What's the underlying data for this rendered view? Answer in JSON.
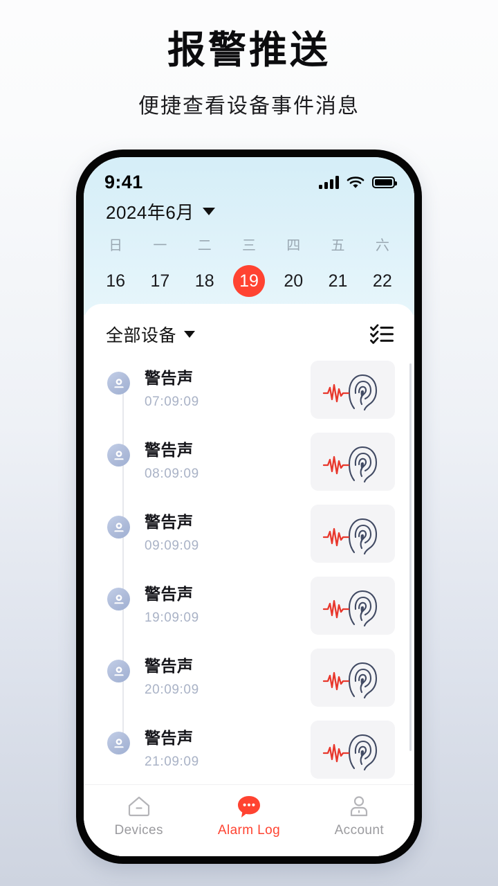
{
  "promo": {
    "title": "报警推送",
    "subtitle": "便捷查看设备事件消息"
  },
  "colors": {
    "accent": "#ff4331",
    "page_bg_top": "#fcfcfd",
    "page_bg_bottom": "#ced4e0",
    "calendar_bg": "#ddf1f9",
    "thumb_bg": "#f4f4f6",
    "wave_red": "#e8372c",
    "ear_navy": "#414a63",
    "device_icon": "#aebbd9",
    "muted_text": "#a9b2c6",
    "tab_inactive": "#9a9a9e"
  },
  "statusbar": {
    "time": "9:41",
    "signal_icon": "cellular-signal-icon",
    "wifi_icon": "wifi-icon",
    "battery_icon": "battery-full-icon"
  },
  "header": {
    "month_label": "2024年6月",
    "caret_icon": "chevron-down-icon"
  },
  "calendar": {
    "weekday_names": [
      "日",
      "一",
      "二",
      "三",
      "四",
      "五",
      "六"
    ],
    "days": [
      {
        "num": "16",
        "selected": false,
        "has_event": true
      },
      {
        "num": "17",
        "selected": false,
        "has_event": true
      },
      {
        "num": "18",
        "selected": false,
        "has_event": true
      },
      {
        "num": "19",
        "selected": true,
        "has_event": true
      },
      {
        "num": "20",
        "selected": false,
        "has_event": false
      },
      {
        "num": "21",
        "selected": false,
        "has_event": false
      },
      {
        "num": "22",
        "selected": false,
        "has_event": false
      }
    ]
  },
  "filterbar": {
    "device_filter_label": "全部设备",
    "caret_icon": "chevron-down-icon",
    "select_icon": "checklist-select-icon"
  },
  "alarm_list": {
    "items": [
      {
        "title": "警告声",
        "time": "07:09:09",
        "device_icon": "camera-icon",
        "thumb_icon": "ear-soundwave-icon"
      },
      {
        "title": "警告声",
        "time": "08:09:09",
        "device_icon": "camera-icon",
        "thumb_icon": "ear-soundwave-icon"
      },
      {
        "title": "警告声",
        "time": "09:09:09",
        "device_icon": "camera-icon",
        "thumb_icon": "ear-soundwave-icon"
      },
      {
        "title": "警告声",
        "time": "19:09:09",
        "device_icon": "camera-icon",
        "thumb_icon": "ear-soundwave-icon"
      },
      {
        "title": "警告声",
        "time": "20:09:09",
        "device_icon": "camera-icon",
        "thumb_icon": "ear-soundwave-icon"
      },
      {
        "title": "警告声",
        "time": "21:09:09",
        "device_icon": "camera-icon",
        "thumb_icon": "ear-soundwave-icon"
      }
    ]
  },
  "tabbar": {
    "tabs": [
      {
        "label": "Devices",
        "icon": "home-icon",
        "active": false
      },
      {
        "label": "Alarm Log",
        "icon": "chat-bubble-icon",
        "active": true
      },
      {
        "label": "Account",
        "icon": "person-icon",
        "active": false
      }
    ]
  }
}
